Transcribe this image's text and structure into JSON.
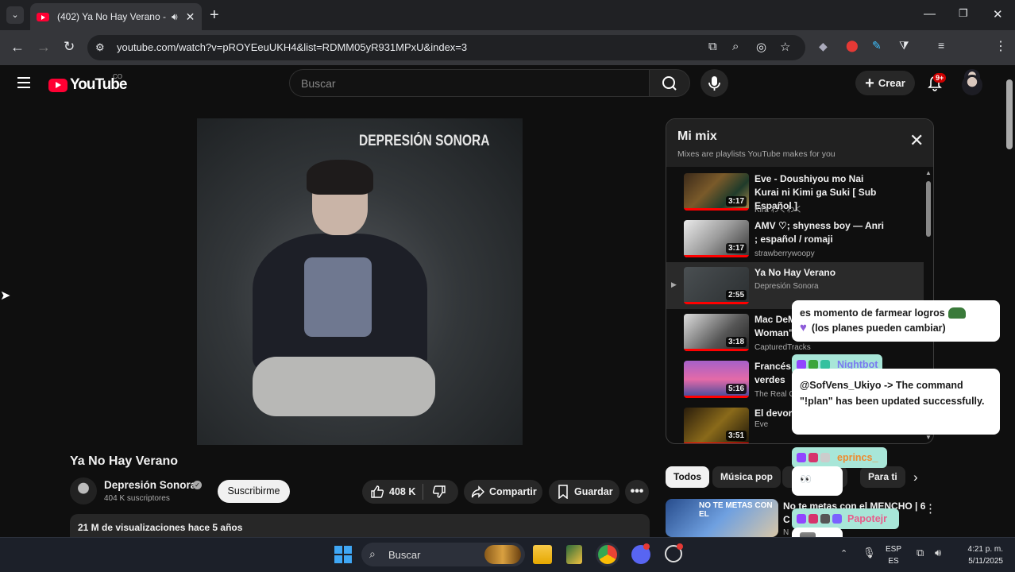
{
  "browser": {
    "tab_title": "(402) Ya No Hay Verano - YouTube",
    "url": "youtube.com/watch?v=pROYEeuUKH4&list=RDMM05yR931MPxU&index=3"
  },
  "header": {
    "logo_text": "YouTube",
    "country_code": "CO",
    "search_placeholder": "Buscar",
    "create_label": "Crear",
    "notif_badge": "9+"
  },
  "video": {
    "overlay_caption": "DEPRESIÓN SONORA",
    "title": "Ya No Hay Verano",
    "channel": "Depresión Sonora",
    "subscribers": "404 K suscriptores",
    "subscribe_label": "Suscribirme",
    "likes": "408 K",
    "share_label": "Compartir",
    "save_label": "Guardar",
    "views": "21 M de visualizaciones  hace 5 años"
  },
  "playlist": {
    "title": "Mi mix",
    "subtitle": "Mixes are playlists YouTube makes for you",
    "items": [
      {
        "title": "Eve - Doushiyou mo Nai Kurai ni Kimi ga Suki [ Sub Español ]",
        "channel": "Kira わくわく",
        "duration": "3:17"
      },
      {
        "title": "AMV ♡; shyness boy — Anri ; español / romaji",
        "channel": "strawberrywoopy",
        "duration": "3:17"
      },
      {
        "title": "Ya No Hay Verano",
        "channel": "Depresión Sonora",
        "duration": "2:55"
      },
      {
        "title": "Mac DeM",
        "title2": "Woman\"",
        "channel": "CapturedTracks",
        "duration": "3:18"
      },
      {
        "title": "Francés",
        "title2": "verdes",
        "channel": "The Real C",
        "duration": "5:16"
      },
      {
        "title": "El devora",
        "channel": "Eve",
        "duration": "3:51"
      }
    ]
  },
  "chips": [
    "Todos",
    "Música pop",
    "s",
    "Para ti"
  ],
  "next_video": {
    "title": "No te metas con el MENCHO | 6",
    "title2": "C",
    "channel": "N",
    "thumb_text": "NO TE METAS CON EL"
  },
  "chat": {
    "msg1": "es momento de farmear logros",
    "msg1b": "(los planes pueden cambiar)",
    "user2": "Nightbot",
    "msg2": "@SofVens_Ukiyo -> The command \"!plan\" has been updated successfully.",
    "user3": "eprincs_",
    "msg3": "👀",
    "user4": "Papotejr"
  },
  "taskbar": {
    "search_placeholder": "Buscar",
    "lang1": "ESP",
    "lang2": "ES",
    "time": "4:21 p. m.",
    "date": "5/11/2025"
  }
}
